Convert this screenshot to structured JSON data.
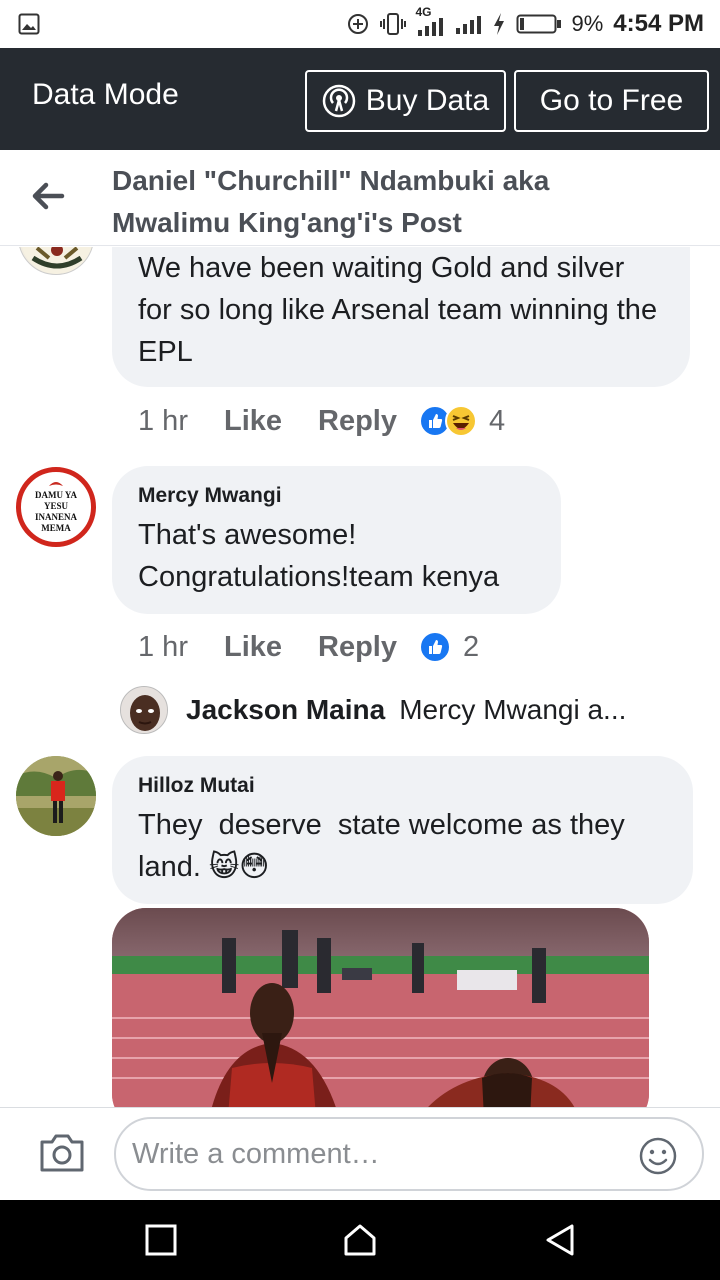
{
  "status_bar": {
    "network": "4G",
    "battery_percent": "9%",
    "time": "4:54 PM"
  },
  "data_bar": {
    "title": "Data Mode",
    "buy_label": "Buy Data",
    "free_label": "Go to Free"
  },
  "header": {
    "title": "Daniel \"Churchill\" Ndambuki aka Mwalimu King'ang'i's Post"
  },
  "comments": [
    {
      "text": "We have been waiting Gold and silver for so long like Arsenal team winning the EPL",
      "time": "1 hr",
      "like_label": "Like",
      "reply_label": "Reply",
      "reaction_count": "4",
      "reactions": [
        "like-icon",
        "haha-icon"
      ]
    },
    {
      "author": "Mercy Mwangi",
      "avatar_text": [
        "DAMU YA",
        "YESU",
        "INANENA",
        "MEMA"
      ],
      "text": "That's awesome! Congratulations!team kenya",
      "time": "1 hr",
      "like_label": "Like",
      "reply_label": "Reply",
      "reaction_count": "2",
      "reactions": [
        "like-icon"
      ]
    },
    {
      "author": "Hilloz Mutai",
      "text": "They  deserve  state welcome as they land. 😸😳"
    }
  ],
  "reply_preview": {
    "author": "Jackson Maina",
    "text": "Mercy Mwangi a..."
  },
  "composer": {
    "placeholder": "Write a comment…"
  },
  "colors": {
    "data_bar_bg": "#262b31",
    "bubble_bg": "#f0f2f5",
    "like_blue": "#1877f2",
    "secondary_text": "#65676b"
  }
}
